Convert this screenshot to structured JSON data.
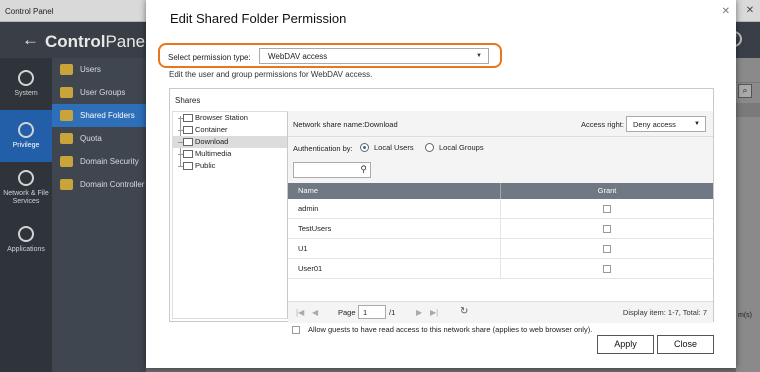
{
  "window": {
    "title": "Control Panel",
    "buttons": [
      "–",
      "□",
      "✕"
    ]
  },
  "app": {
    "back_glyph": "←",
    "title_bold": "Control",
    "title_rest": "Panel",
    "help_glyph": "?"
  },
  "left_nav": [
    {
      "label": "System",
      "icon": "gear-icon"
    },
    {
      "label": "Privilege",
      "icon": "user-icon",
      "active": true
    },
    {
      "label": "Network & File Services",
      "icon": "globe-icon"
    },
    {
      "label": "Applications",
      "icon": "apps-icon"
    }
  ],
  "sub_nav": [
    {
      "label": "Users"
    },
    {
      "label": "User Groups"
    },
    {
      "label": "Shared Folders",
      "selected": true
    },
    {
      "label": "Quota"
    },
    {
      "label": "Domain Security"
    },
    {
      "label": "Domain Controller"
    }
  ],
  "bg_right": {
    "search_glyph": "⌕",
    "trail_text": "m(s)"
  },
  "dialog": {
    "title": "Edit Shared Folder Permission",
    "close_glyph": "✕",
    "permission_type_label": "Select permission type:",
    "permission_type_value": "WebDAV access",
    "description": "Edit the user and group permissions for WebDAV access.",
    "shares_header": "Shares",
    "tree": [
      "Browser Station",
      "Container",
      "Download",
      "Multimedia",
      "Public"
    ],
    "network_share_name": "Network share name:Download",
    "access_right_label": "Access right:",
    "access_right_value": "Deny access",
    "auth_label": "Authentication by:",
    "auth_options": [
      "Local Users",
      "Local Groups"
    ],
    "table": {
      "col_name": "Name",
      "col_grant": "Grant",
      "rows": [
        "admin",
        "TestUsers",
        "U1",
        "User01"
      ]
    },
    "pager": {
      "first": "|◀",
      "prev": "◀",
      "next": "▶",
      "last": "▶|",
      "page_label": "Page",
      "page_value": "1",
      "total_pages": "/1",
      "refresh_glyph": "↻",
      "display": "Display item: 1-7, Total: 7"
    },
    "guest_text": "Allow guests to have read access to this network share (applies to web browser only).",
    "apply_label": "Apply",
    "close_label": "Close"
  }
}
